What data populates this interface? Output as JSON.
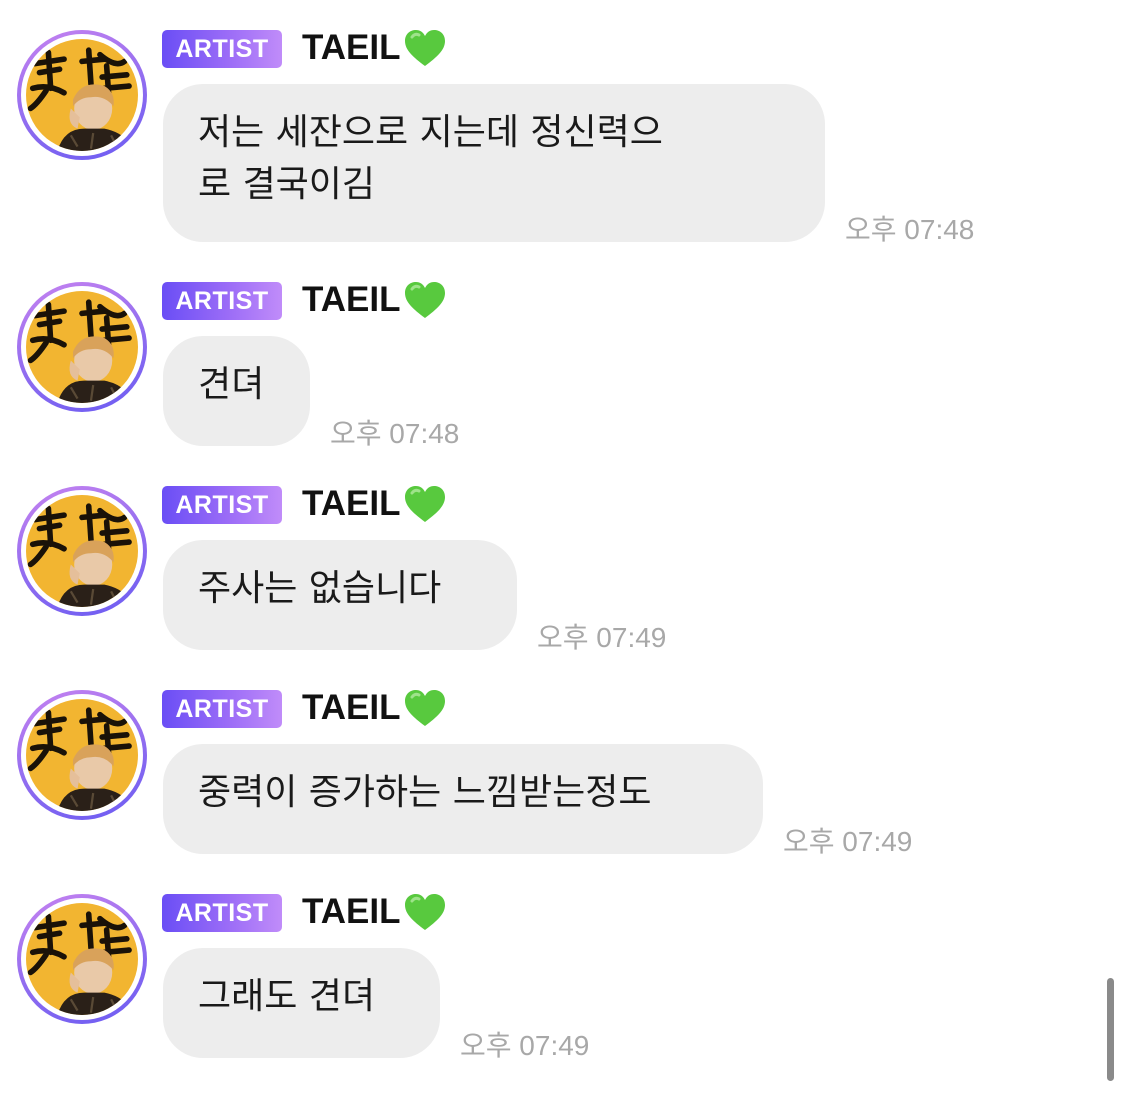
{
  "messages": [
    {
      "badge": "ARTIST",
      "sender": "TAEIL",
      "text": "저는 세잔으로 지는데 정신력으\n로 결국이김",
      "time": "오후 07:48"
    },
    {
      "badge": "ARTIST",
      "sender": "TAEIL",
      "text": "견뎌",
      "time": "오후 07:48"
    },
    {
      "badge": "ARTIST",
      "sender": "TAEIL",
      "text": "주사는 없습니다",
      "time": "오후 07:49"
    },
    {
      "badge": "ARTIST",
      "sender": "TAEIL",
      "text": "중력이 증가하는 느낌받는정도",
      "time": "오후 07:49"
    },
    {
      "badge": "ARTIST",
      "sender": "TAEIL",
      "text": "그래도 견뎌",
      "time": "오후 07:49"
    }
  ],
  "icons": {
    "name_suffix": "green-heart-icon",
    "avatar": "avatar-photo"
  },
  "colors": {
    "badge_gradient_start": "#6a4ef5",
    "badge_gradient_end": "#c08cf9",
    "bubble": "#ededed",
    "timestamp": "#a8a8a8",
    "heart": "#58c93e",
    "avatar_background": "#f2b531"
  }
}
